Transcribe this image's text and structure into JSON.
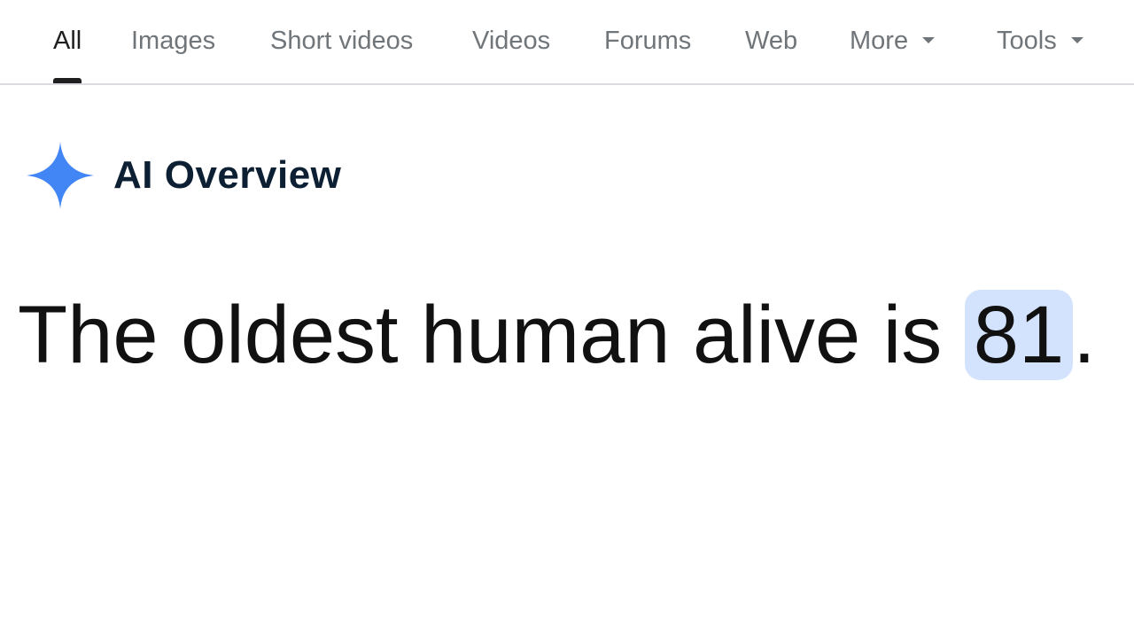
{
  "tabs": [
    {
      "label": "All",
      "active": true
    },
    {
      "label": "Images"
    },
    {
      "label": "Short videos"
    },
    {
      "label": "Videos"
    },
    {
      "label": "Forums"
    },
    {
      "label": "Web"
    },
    {
      "label": "More",
      "icon": "chevron-down-icon"
    },
    {
      "label": "Tools",
      "icon": "chevron-down-icon"
    }
  ],
  "ai_overview": {
    "title": "AI Overview",
    "icon": "sparkle-icon",
    "icon_color": "#4285f4"
  },
  "answer": {
    "prefix": "The oldest human alive is ",
    "highlight": "81",
    "suffix": ".",
    "highlight_color": "#d3e3fd"
  }
}
